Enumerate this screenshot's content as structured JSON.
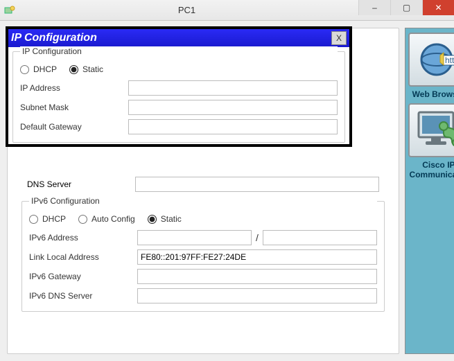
{
  "window": {
    "title": "PC1",
    "minimize": "–",
    "maximize": "▢",
    "close": "✕"
  },
  "ip_panel": {
    "title": "IP Configuration",
    "close": "X",
    "section_label": "IP Configuration",
    "dhcp_label": "DHCP",
    "static_label": "Static",
    "selected_mode": "Static",
    "ip_address_label": "IP Address",
    "ip_address_value": "",
    "subnet_mask_label": "Subnet Mask",
    "subnet_mask_value": "",
    "default_gateway_label": "Default Gateway",
    "default_gateway_value": ""
  },
  "dns": {
    "label": "DNS Server",
    "value": ""
  },
  "ipv6": {
    "section_label": "IPv6 Configuration",
    "dhcp_label": "DHCP",
    "auto_label": "Auto Config",
    "static_label": "Static",
    "selected_mode": "Static",
    "address_label": "IPv6 Address",
    "address_value": "",
    "prefix_value": "",
    "link_local_label": "Link Local Address",
    "link_local_value": "FE80::201:97FF:FE27:24DE",
    "gateway_label": "IPv6 Gateway",
    "gateway_value": "",
    "dns_label": "IPv6 DNS Server",
    "dns_value": ""
  },
  "sidebar": {
    "web_browser": "Web Browser",
    "cisco_ip_comm_line1": "Cisco IP",
    "cisco_ip_comm_line2": "Communicator"
  }
}
